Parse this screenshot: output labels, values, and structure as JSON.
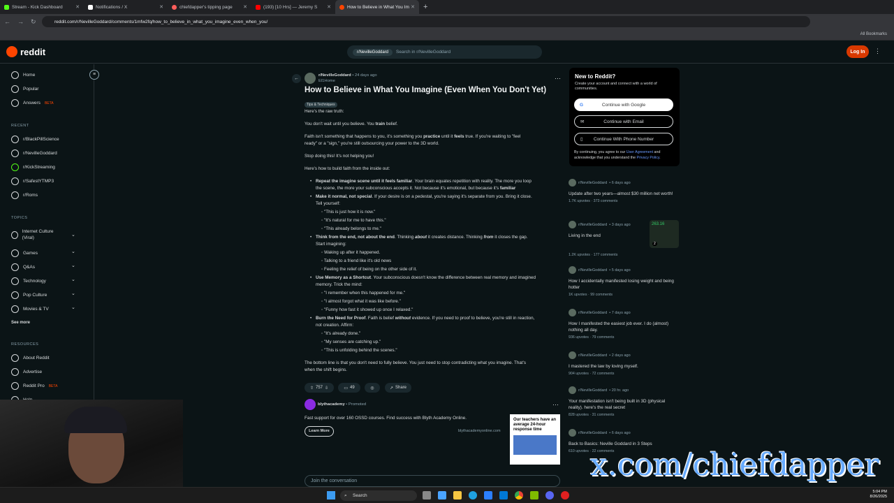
{
  "browser": {
    "tabs": [
      {
        "label": "Stream - Kick Dashboard",
        "color": "#53fc18"
      },
      {
        "label": "Notifications / X",
        "color": "#ffffff"
      },
      {
        "label": "chiefdapper's tipping page",
        "color": "#ff5e5b"
      },
      {
        "label": "(193) [10 Hrs] — Jeremy S",
        "color": "#ff0000"
      },
      {
        "label": "How to Believe in What You Im",
        "color": "#ff4500"
      }
    ],
    "url": "reddit.com/r/NevilleGoddard/comments/1mfw2fq/how_to_believe_in_what_you_imagine_even_when_you/",
    "all_bookmarks": "All Bookmarks"
  },
  "header": {
    "logo": "reddit",
    "search_chip": "r/NevilleGoddard",
    "search_placeholder": "Search in r/NevilleGoddard",
    "login": "Log In"
  },
  "sidebar": {
    "main": [
      {
        "label": "Home"
      },
      {
        "label": "Popular"
      },
      {
        "label": "Answers",
        "badge": "BETA"
      }
    ],
    "recent_heading": "RECENT",
    "recent": [
      "r/BlackPillScience",
      "r/NevilleGoddard",
      "r/KickStreaming",
      "r/SafestYTMP3",
      "r/Roms"
    ],
    "topics_heading": "TOPICS",
    "topics": [
      "Internet Culture (Viral)",
      "Games",
      "Q&As",
      "Technology",
      "Pop Culture",
      "Movies & TV"
    ],
    "see_more": "See more",
    "resources_heading": "RESOURCES",
    "resources": [
      {
        "label": "About Reddit"
      },
      {
        "label": "Advertise"
      },
      {
        "label": "Reddit Pro",
        "badge": "BETA"
      },
      {
        "label": "Help"
      }
    ]
  },
  "post": {
    "subreddit": "r/NevilleGoddard",
    "age": "• 24 days ago",
    "author": "El1Home",
    "title": "How to Believe in What You Imagine (Even When You Don't Yet)",
    "flair": "Tips & Techniques",
    "p1": "Here's the raw truth:",
    "p2a": "You don't wait until you believe. You ",
    "p2b": "train",
    "p2c": " belief.",
    "p3a": "Faith isn't something that happens to you, it's something you ",
    "p3b": "practice",
    "p3c": " until it ",
    "p3d": "feels",
    "p3e": " true. If you're waiting to \"feel",
    "p3f": "ready\" or a \"sign,\" you're still outsourcing your power to the 3D world.",
    "p4": "Stop doing this! It's not helping you!",
    "p5": "Here's how to build faith from the inside out:",
    "i1a": "Repeat the imagine scene until it feels familiar",
    "i1b": ". Your brain equates repetition with reality. The more you loop",
    "i1c": "the scene, the more your subconscious accepts it. Not because it's emotional, but because it's ",
    "i1d": "familiar",
    "i2a": "Make it normal, not special",
    "i2b": ". If your desire is on a pedestal, you're saying it's separate from you. Bring it close.",
    "i2c": "Tell yourself:",
    "i2s": [
      "\"This is just how it is now.\"",
      "\"It's natural for me to have this.\"",
      "\"This already belongs to me.\""
    ],
    "i3a": "Think from the end, not about the end",
    "i3b": ". Thinking ",
    "i3c": "about",
    "i3d": " it creates distance. Thinking ",
    "i3e": "from",
    "i3f": " it closes the gap.",
    "i3g": "Start imagining:",
    "i3s": [
      "Waking up after it happened.",
      "Talking to a friend like it's old news",
      "Feeling the relief of being on the other side of it."
    ],
    "i4a": "Use Memory as a Shortcut",
    "i4b": ". Your subconscious doesn't know the difference between real memory and imagined",
    "i4c": "memory. Trick the mind:",
    "i4s": [
      "\"I remember when this happened for me.\"",
      "\"I almost forgot what it was like before.\"",
      "\"Funny how fast it showed up once I relaxed.\""
    ],
    "i5a": "Burn the Need for Proof",
    "i5b": ". Faith is belief ",
    "i5c": "without",
    "i5d": " evidence. If you need to proof to believe, you're still in reaction,",
    "i5e": "not creation. Affirm:",
    "i5s": [
      "\"It's already done.\"",
      "\"My senses are catching up.\"",
      "\"This is unfolding behind the scenes.\""
    ],
    "p6": "The bottom line is that you don't need to fully believe. You just need to stop contradicting what you imagine. That's",
    "p7": "when the shift begins.",
    "votes": "757",
    "comments": "49",
    "share": "Share"
  },
  "promo": {
    "name": "blythacademy",
    "tag": "• Promoted",
    "text": "Fast support for over 160 OSSD courses. Find success with Blyth Academy Online.",
    "cta": "Learn More",
    "domain": "blythacademyonline.com",
    "ad_text": "Our teachers have an average 24-hour response time"
  },
  "join": "Join the conversation",
  "new_card": {
    "title": "New to Reddit?",
    "desc": "Create your account and connect with a world of communities.",
    "google": "Continue with Google",
    "email": "Continue with Email",
    "phone": "Continue With Phone Number",
    "legal1": "By continuing, you agree to our ",
    "ua": "User Agreement",
    "legal2": " and acknowledge that you understand the ",
    "pp": "Privacy Policy",
    "legal3": "."
  },
  "related": [
    {
      "sub": "r/NevilleGoddard",
      "age": "• 6 days ago",
      "title": "Update after two years—almost $30 million net worth!",
      "meta": "1.7K upvotes · 373 comments"
    },
    {
      "sub": "r/NevilleGoddard",
      "age": "• 3 days ago",
      "title": "Living in the end",
      "meta": "1.2K upvotes · 177 comments"
    },
    {
      "sub": "r/NevilleGoddard",
      "age": "• 5 days ago",
      "title": "How I accidentally manifested losing weight and being hotter",
      "meta": "1K upvotes · 99 comments"
    },
    {
      "sub": "r/NevilleGoddard",
      "age": "• 7 days ago",
      "title": "How I manifested the easiest job ever. I do (almost) nothing all day.",
      "meta": "936 upvotes · 79 comments"
    },
    {
      "sub": "r/NevilleGoddard",
      "age": "• 2 days ago",
      "title": "I mastered the law by loving myself.",
      "meta": "904 upvotes · 72 comments"
    },
    {
      "sub": "r/NevilleGoddard",
      "age": "• 20 hr. ago",
      "title": "Your manifestation isn't being built in 3D (physical reality). here's the real secret",
      "meta": "828 upvotes · 31 comments"
    },
    {
      "sub": "r/NevilleGoddard",
      "age": "• 6 days ago",
      "title": "Back to Basics: Neville Goddard in 3 Steps",
      "meta": "610 upvotes · 22 comments"
    }
  ],
  "thumb": {
    "value": "263.16",
    "badge": "2"
  },
  "watermark": "x.com/chiefdapper",
  "taskbar": {
    "search": "Search",
    "time": "5:04 PM",
    "date": "8/26/2025"
  }
}
